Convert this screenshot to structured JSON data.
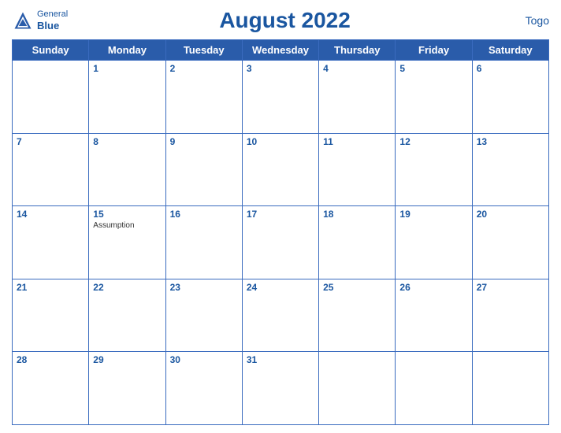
{
  "header": {
    "logo_general": "General",
    "logo_blue": "Blue",
    "title": "August 2022",
    "country": "Togo"
  },
  "days_of_week": [
    "Sunday",
    "Monday",
    "Tuesday",
    "Wednesday",
    "Thursday",
    "Friday",
    "Saturday"
  ],
  "weeks": [
    [
      {
        "num": "",
        "event": ""
      },
      {
        "num": "1",
        "event": ""
      },
      {
        "num": "2",
        "event": ""
      },
      {
        "num": "3",
        "event": ""
      },
      {
        "num": "4",
        "event": ""
      },
      {
        "num": "5",
        "event": ""
      },
      {
        "num": "6",
        "event": ""
      }
    ],
    [
      {
        "num": "7",
        "event": ""
      },
      {
        "num": "8",
        "event": ""
      },
      {
        "num": "9",
        "event": ""
      },
      {
        "num": "10",
        "event": ""
      },
      {
        "num": "11",
        "event": ""
      },
      {
        "num": "12",
        "event": ""
      },
      {
        "num": "13",
        "event": ""
      }
    ],
    [
      {
        "num": "14",
        "event": ""
      },
      {
        "num": "15",
        "event": "Assumption"
      },
      {
        "num": "16",
        "event": ""
      },
      {
        "num": "17",
        "event": ""
      },
      {
        "num": "18",
        "event": ""
      },
      {
        "num": "19",
        "event": ""
      },
      {
        "num": "20",
        "event": ""
      }
    ],
    [
      {
        "num": "21",
        "event": ""
      },
      {
        "num": "22",
        "event": ""
      },
      {
        "num": "23",
        "event": ""
      },
      {
        "num": "24",
        "event": ""
      },
      {
        "num": "25",
        "event": ""
      },
      {
        "num": "26",
        "event": ""
      },
      {
        "num": "27",
        "event": ""
      }
    ],
    [
      {
        "num": "28",
        "event": ""
      },
      {
        "num": "29",
        "event": ""
      },
      {
        "num": "30",
        "event": ""
      },
      {
        "num": "31",
        "event": ""
      },
      {
        "num": "",
        "event": ""
      },
      {
        "num": "",
        "event": ""
      },
      {
        "num": "",
        "event": ""
      }
    ]
  ],
  "colors": {
    "header_bg": "#2a5caa",
    "header_text": "#ffffff",
    "title_color": "#1a56a0",
    "day_num_color": "#1a56a0",
    "border_color": "#3a6bbf"
  }
}
